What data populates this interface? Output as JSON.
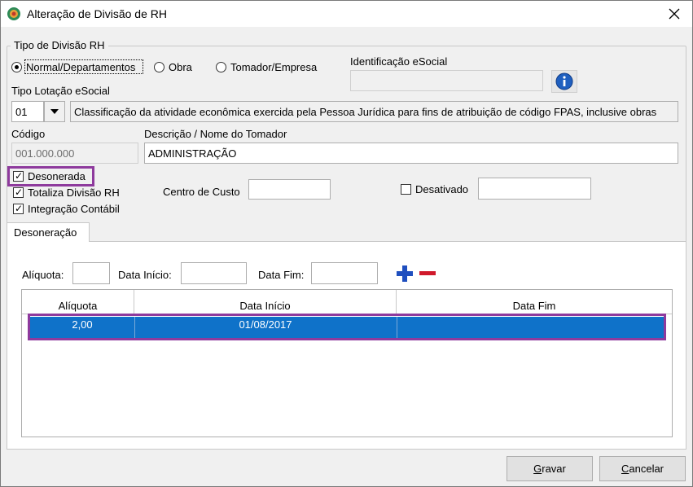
{
  "window": {
    "title": "Alteração de Divisão de RH"
  },
  "tipo_divisao": {
    "legend": "Tipo de Divisão RH",
    "options": [
      "Normal/Departamentos",
      "Obra",
      "Tomador/Empresa"
    ],
    "selected": "Normal/Departamentos"
  },
  "esocial": {
    "id_label": "Identificação eSocial",
    "id_value": "",
    "lotacao_label": "Tipo Lotação eSocial",
    "lotacao_code": "01",
    "lotacao_desc": "Classificação da atividade econômica exercida pela Pessoa Jurídica para fins de atribuição de código FPAS, inclusive obras"
  },
  "codigo": {
    "label": "Código",
    "value": "001.000.000"
  },
  "descricao": {
    "label": "Descrição / Nome do Tomador",
    "value": "ADMINISTRAÇÃO"
  },
  "flags": {
    "desonerada": "Desonerada",
    "totaliza": "Totaliza Divisão RH",
    "integracao": "Integração Contábil",
    "centro_custo_label": "Centro de Custo",
    "centro_custo_value": "",
    "desativado": "Desativado",
    "desativado_value": ""
  },
  "tab": {
    "label": "Desoneração"
  },
  "filters": {
    "aliquota_label": "Alíquota:",
    "data_inicio_label": "Data Início:",
    "data_fim_label": "Data Fim:"
  },
  "grid": {
    "columns": [
      "Alíquota",
      "Data Início",
      "Data Fim"
    ],
    "rows": [
      {
        "aliquota": "2,00",
        "data_inicio": "01/08/2017",
        "data_fim": ""
      }
    ]
  },
  "buttons": {
    "gravar_u": "G",
    "gravar_rest": "ravar",
    "cancelar_u": "C",
    "cancelar_rest": "ancelar"
  },
  "colors": {
    "selection": "#0f72c9",
    "highlight": "#8e3a9d",
    "plus": "#1f4fbf",
    "minus": "#d0192b"
  }
}
